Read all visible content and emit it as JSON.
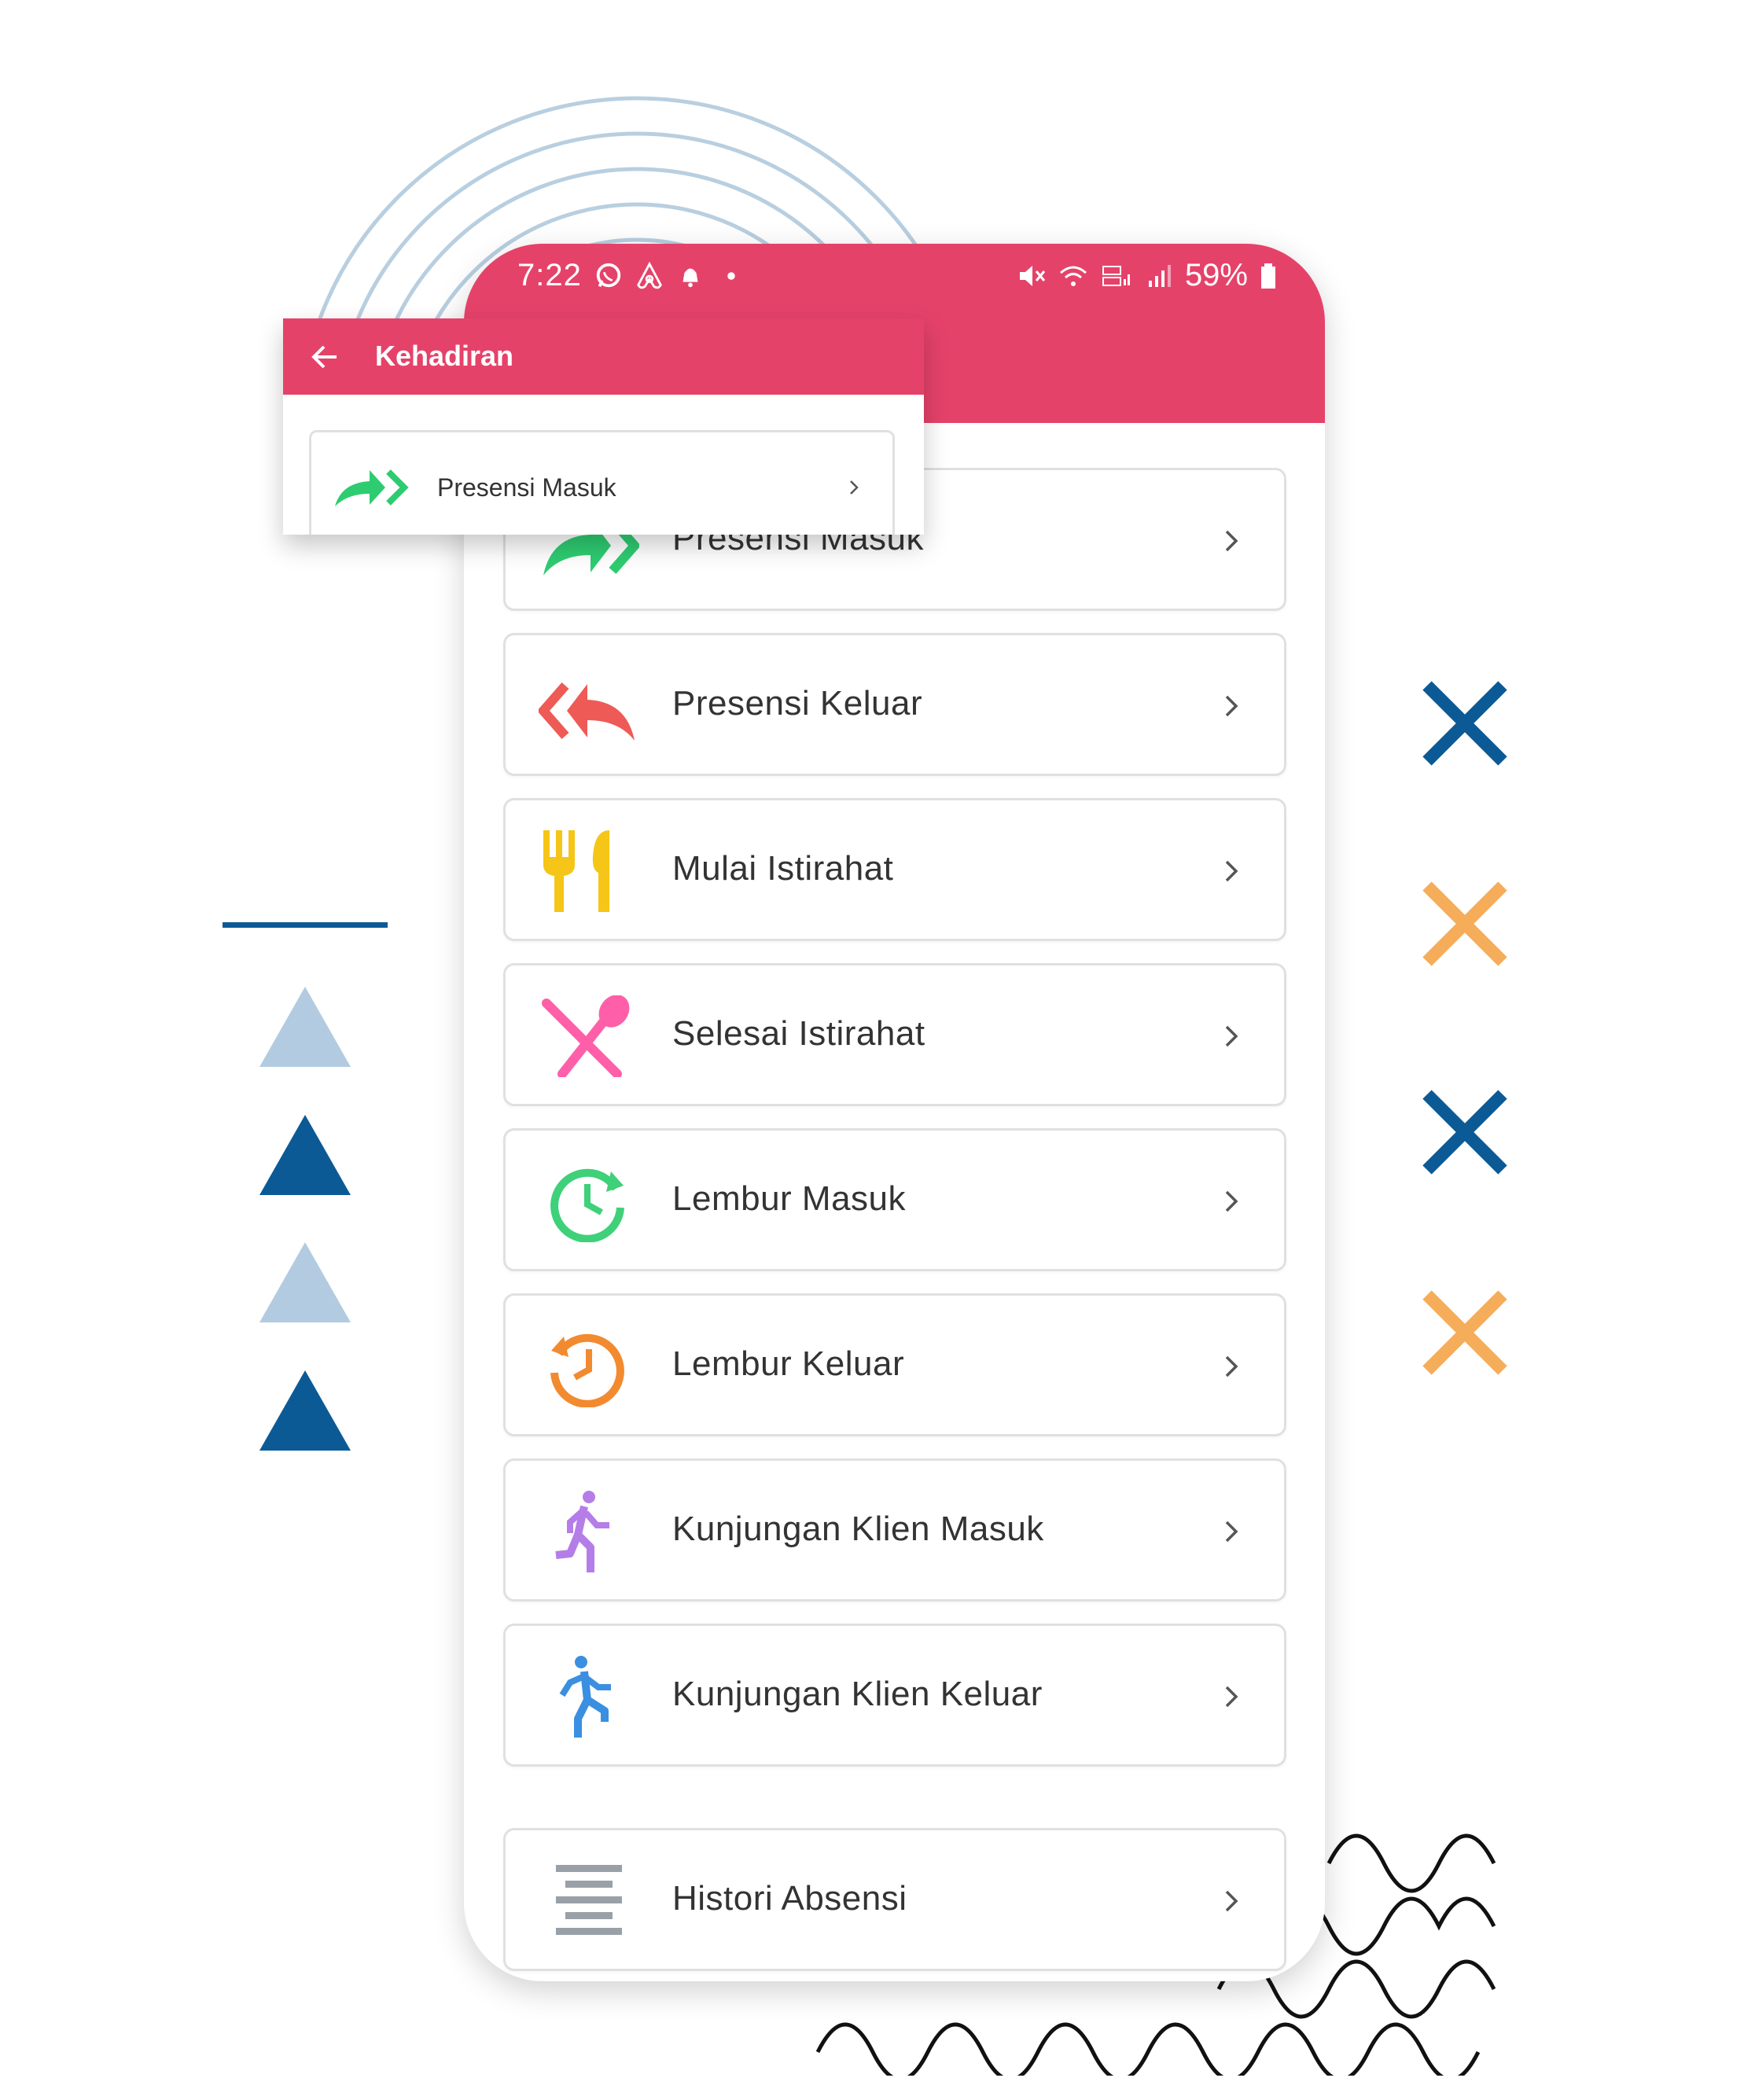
{
  "status_bar": {
    "time": "7:22",
    "left_icons": [
      "whatsapp-icon",
      "airbnb-icon",
      "notification-bell-icon",
      "dot-icon"
    ],
    "right_icons": [
      "mute-icon",
      "wifi-icon",
      "volte-lte-icon",
      "signal-icon",
      "signal-icon"
    ],
    "battery_percent": "59%"
  },
  "app_bar": {
    "title": "Kehadiran",
    "back_icon": "arrow-left-icon"
  },
  "menu": {
    "items": [
      {
        "label": "Presensi Masuk",
        "icon": "check-in-arrow-icon",
        "color": "#2ecc71"
      },
      {
        "label": "Presensi Keluar",
        "icon": "check-out-arrow-icon",
        "color": "#ee5a55"
      },
      {
        "label": "Mulai Istirahat",
        "icon": "fork-knife-icon",
        "color": "#f5c518"
      },
      {
        "label": "Selesai Istirahat",
        "icon": "crossed-utensils-icon",
        "color": "#ff5fa8"
      },
      {
        "label": "Lembur Masuk",
        "icon": "clock-forward-icon",
        "color": "#3fd07a"
      },
      {
        "label": "Lembur Keluar",
        "icon": "clock-history-icon",
        "color": "#f28a30"
      },
      {
        "label": "Kunjungan Klien Masuk",
        "icon": "running-person-icon",
        "color": "#b57de8"
      },
      {
        "label": "Kunjungan Klien Keluar",
        "icon": "running-person-icon",
        "color": "#3b8fe0"
      },
      {
        "label": "Histori Absensi",
        "icon": "list-lines-icon",
        "color": "#9aa0a8"
      }
    ],
    "chevron_icon": "chevron-right-icon"
  },
  "colors": {
    "header": "#e5426a",
    "deco_dark_blue": "#0b5a96",
    "deco_light_blue": "#b3cbe0",
    "deco_orange": "#f5ad5a",
    "arc_stroke": "#b8cfe0"
  }
}
